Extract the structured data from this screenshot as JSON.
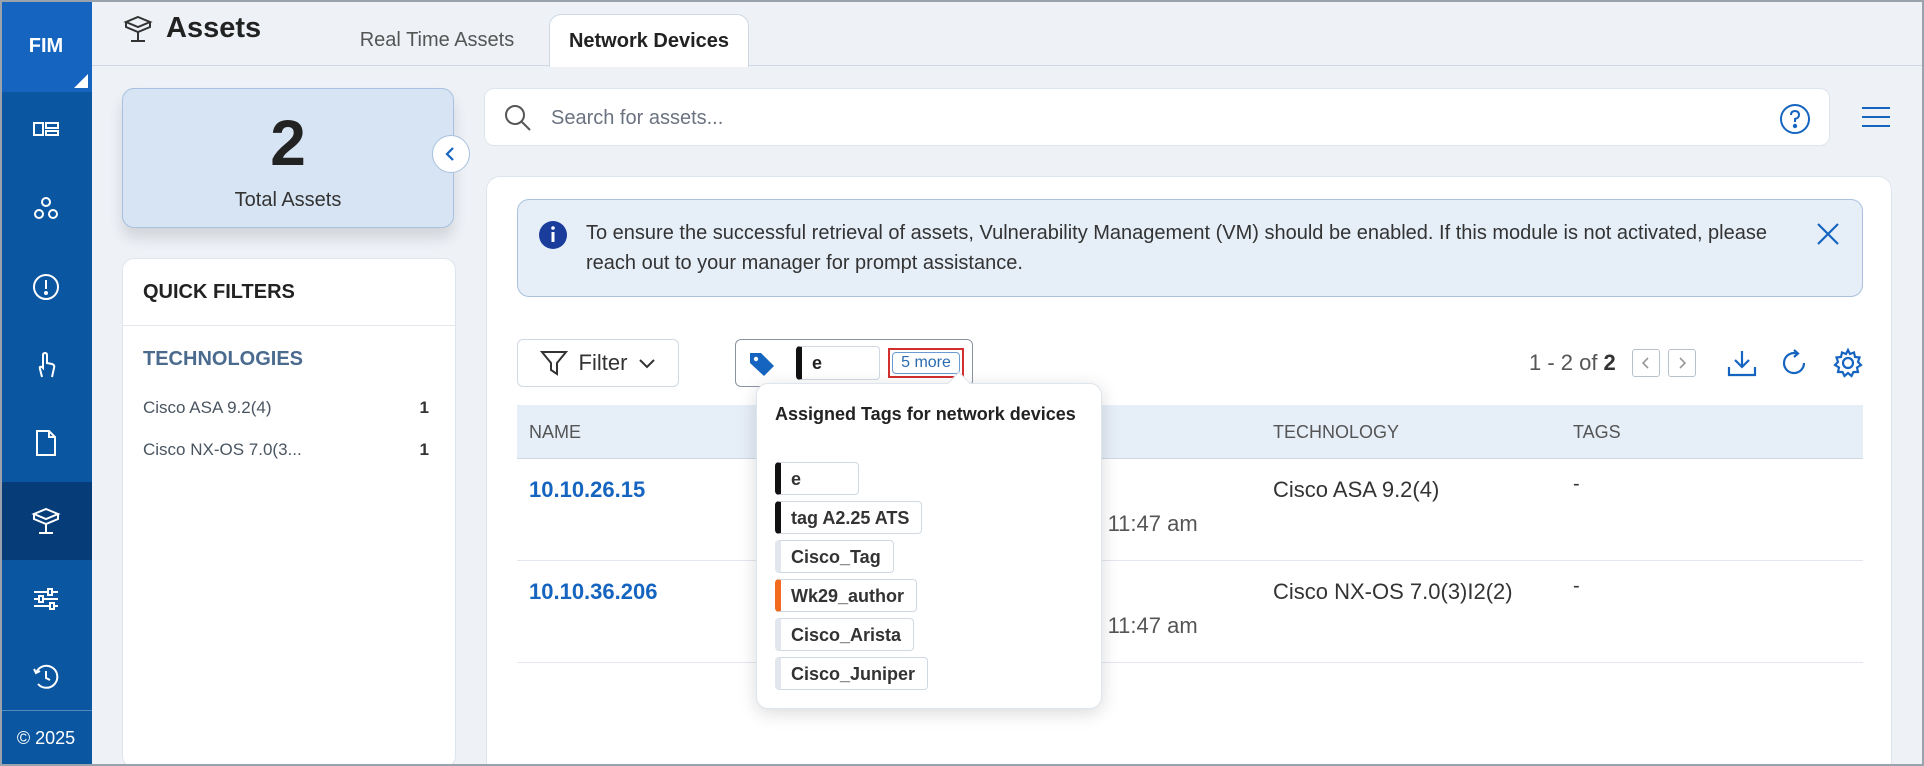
{
  "nav": {
    "brand": "FIM",
    "footer": "© 2025",
    "items": [
      "dashboard",
      "modules",
      "alerts",
      "touch",
      "reports",
      "assets",
      "settings",
      "history"
    ]
  },
  "header": {
    "title": "Assets",
    "tabs": [
      "Real Time Assets",
      "Network Devices"
    ],
    "active_tab": "Network Devices"
  },
  "summary": {
    "count": "2",
    "label": "Total Assets"
  },
  "quick_filters": {
    "title": "QUICK FILTERS",
    "section": "TECHNOLOGIES",
    "items": [
      {
        "label": "Cisco ASA 9.2(4)",
        "count": "1"
      },
      {
        "label": "Cisco NX-OS 7.0(3...",
        "count": "1"
      }
    ]
  },
  "search": {
    "placeholder": "Search for assets...",
    "value": ""
  },
  "alert": {
    "text": "To ensure the successful retrieval of assets, Vulnerability Management (VM) should be enabled. If this module is not activated, please reach out to your manager for prompt assistance."
  },
  "toolbar": {
    "filter_label": "Filter",
    "tag_chip": "e",
    "more_label": "5 more",
    "range": "1 - 2 of",
    "total": "2"
  },
  "table": {
    "columns": [
      "NAME",
      "TECHNOLOGY",
      "TAGS"
    ],
    "rows": [
      {
        "name": "10.10.26.15",
        "date": "25 11:47 am",
        "technology": "Cisco ASA 9.2(4)",
        "tags": "-"
      },
      {
        "name": "10.10.36.206",
        "date": "25 11:47 am",
        "technology": "Cisco NX-OS 7.0(3)I2(2)",
        "tags": "-"
      }
    ]
  },
  "popover": {
    "title": "Assigned Tags for network devices",
    "tags": [
      {
        "label": "e",
        "color": "#111111"
      },
      {
        "label": "tag A2.25 ATS",
        "color": "#111111"
      },
      {
        "label": "Cisco_Tag",
        "color": "#e2e7ed"
      },
      {
        "label": "Wk29_author",
        "color": "#f26b1d"
      },
      {
        "label": "Cisco_Arista",
        "color": "#e2e7ed"
      },
      {
        "label": "Cisco_Juniper",
        "color": "#e2e7ed"
      }
    ]
  },
  "colors": {
    "nav": "#0b56a0",
    "nav_active": "#063d79",
    "link": "#1565c0",
    "highlight": "#d32f2f"
  }
}
